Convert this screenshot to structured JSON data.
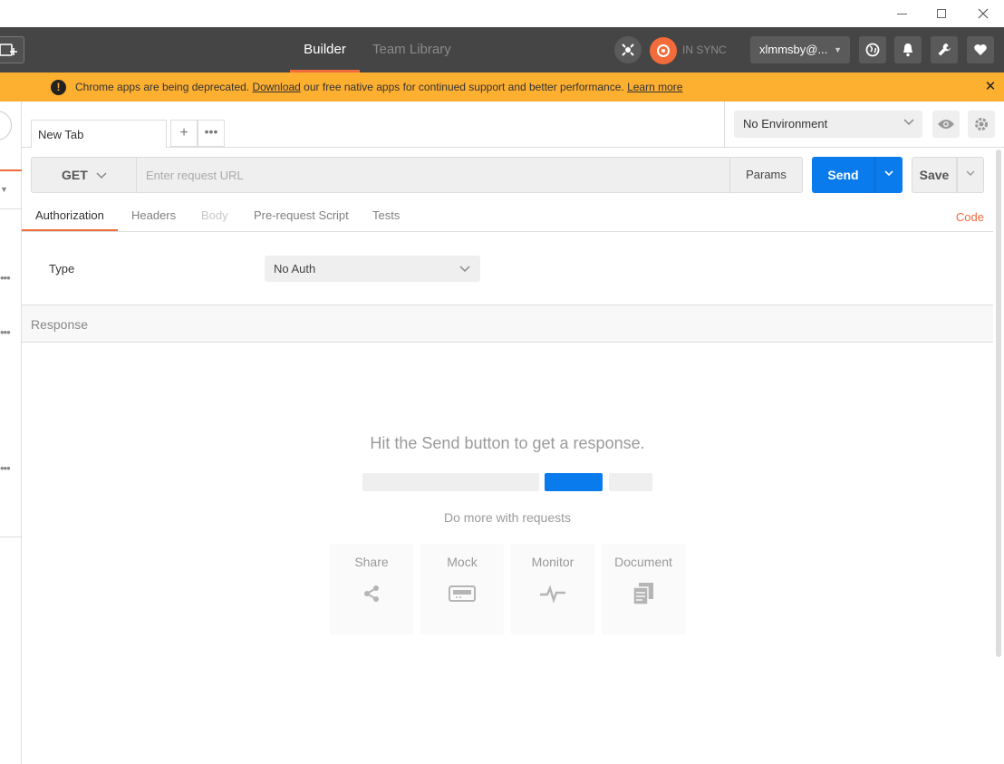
{
  "window": {
    "minimize": "—",
    "maximize": "☐",
    "close": "✕"
  },
  "header": {
    "tabs": [
      "Builder",
      "Team Library"
    ],
    "sync_status": "IN SYNC",
    "user": "xlmmsby@...",
    "accent": "#f26b3a"
  },
  "banner": {
    "text_before": "Chrome apps are being deprecated. ",
    "download_link": "Download",
    "text_after": " our free native apps for continued support and better performance. ",
    "learn_more": "Learn more",
    "close": "✕",
    "color": "#fdaf30"
  },
  "tabs": {
    "active_tab": "New Tab",
    "add": "+",
    "more": "•••"
  },
  "environment": {
    "selected": "No Environment"
  },
  "request": {
    "method": "GET",
    "url_placeholder": "Enter request URL",
    "params": "Params",
    "send": "Send",
    "save": "Save"
  },
  "subtabs": [
    "Authorization",
    "Headers",
    "Body",
    "Pre-request Script",
    "Tests"
  ],
  "code_link": "Code",
  "auth": {
    "type_label": "Type",
    "type_value": "No Auth"
  },
  "response": {
    "header": "Response",
    "hint": "Hit the Send button to get a response.",
    "more": "Do more with requests",
    "cards": [
      "Share",
      "Mock",
      "Monitor",
      "Document"
    ]
  },
  "sidebar": {
    "dots": "•••"
  }
}
